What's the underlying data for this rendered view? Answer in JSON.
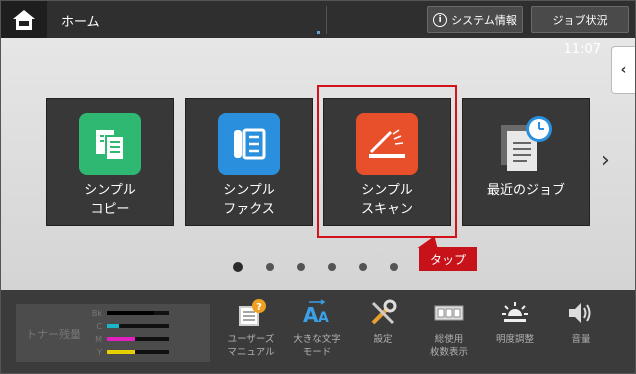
{
  "header": {
    "home_title": "ホーム",
    "system_info_label": "システム情報",
    "job_status_label": "ジョブ状況"
  },
  "main": {
    "clock": "11:07",
    "tiles": [
      {
        "line1": "シンプル",
        "line2": "コピー",
        "color": "#2eb872",
        "icon": "copy-icon"
      },
      {
        "line1": "シンプル",
        "line2": "ファクス",
        "color": "#2a8fdc",
        "icon": "fax-icon"
      },
      {
        "line1": "シンプル",
        "line2": "スキャン",
        "color": "#e8502c",
        "icon": "scan-icon"
      },
      {
        "line1": "最近のジョブ",
        "line2": "",
        "color": "#5a5a5a",
        "icon": "recent-jobs-icon"
      }
    ],
    "tap_callout": "タップ",
    "page_count": 6,
    "active_page": 1
  },
  "bottom": {
    "toner": {
      "label": "トナー残量",
      "levels": [
        {
          "name": "Bk",
          "level": 0.75,
          "color": "#000000"
        },
        {
          "name": "C",
          "level": 0.2,
          "color": "#1ab7c9"
        },
        {
          "name": "M",
          "level": 0.45,
          "color": "#e020c0"
        },
        {
          "name": "Y",
          "level": 0.45,
          "color": "#e8d000"
        }
      ]
    },
    "items": [
      {
        "line1": "ユーザーズ",
        "line2": "マニュアル",
        "icon": "user-manual-icon"
      },
      {
        "line1": "大きな文字",
        "line2": "モード",
        "icon": "large-text-icon"
      },
      {
        "line1": "設定",
        "line2": "",
        "icon": "settings-icon"
      },
      {
        "line1": "総使用",
        "line2": "枚数表示",
        "icon": "counter-icon"
      },
      {
        "line1": "明度調整",
        "line2": "",
        "icon": "brightness-icon"
      },
      {
        "line1": "音量",
        "line2": "",
        "icon": "volume-icon"
      }
    ]
  }
}
